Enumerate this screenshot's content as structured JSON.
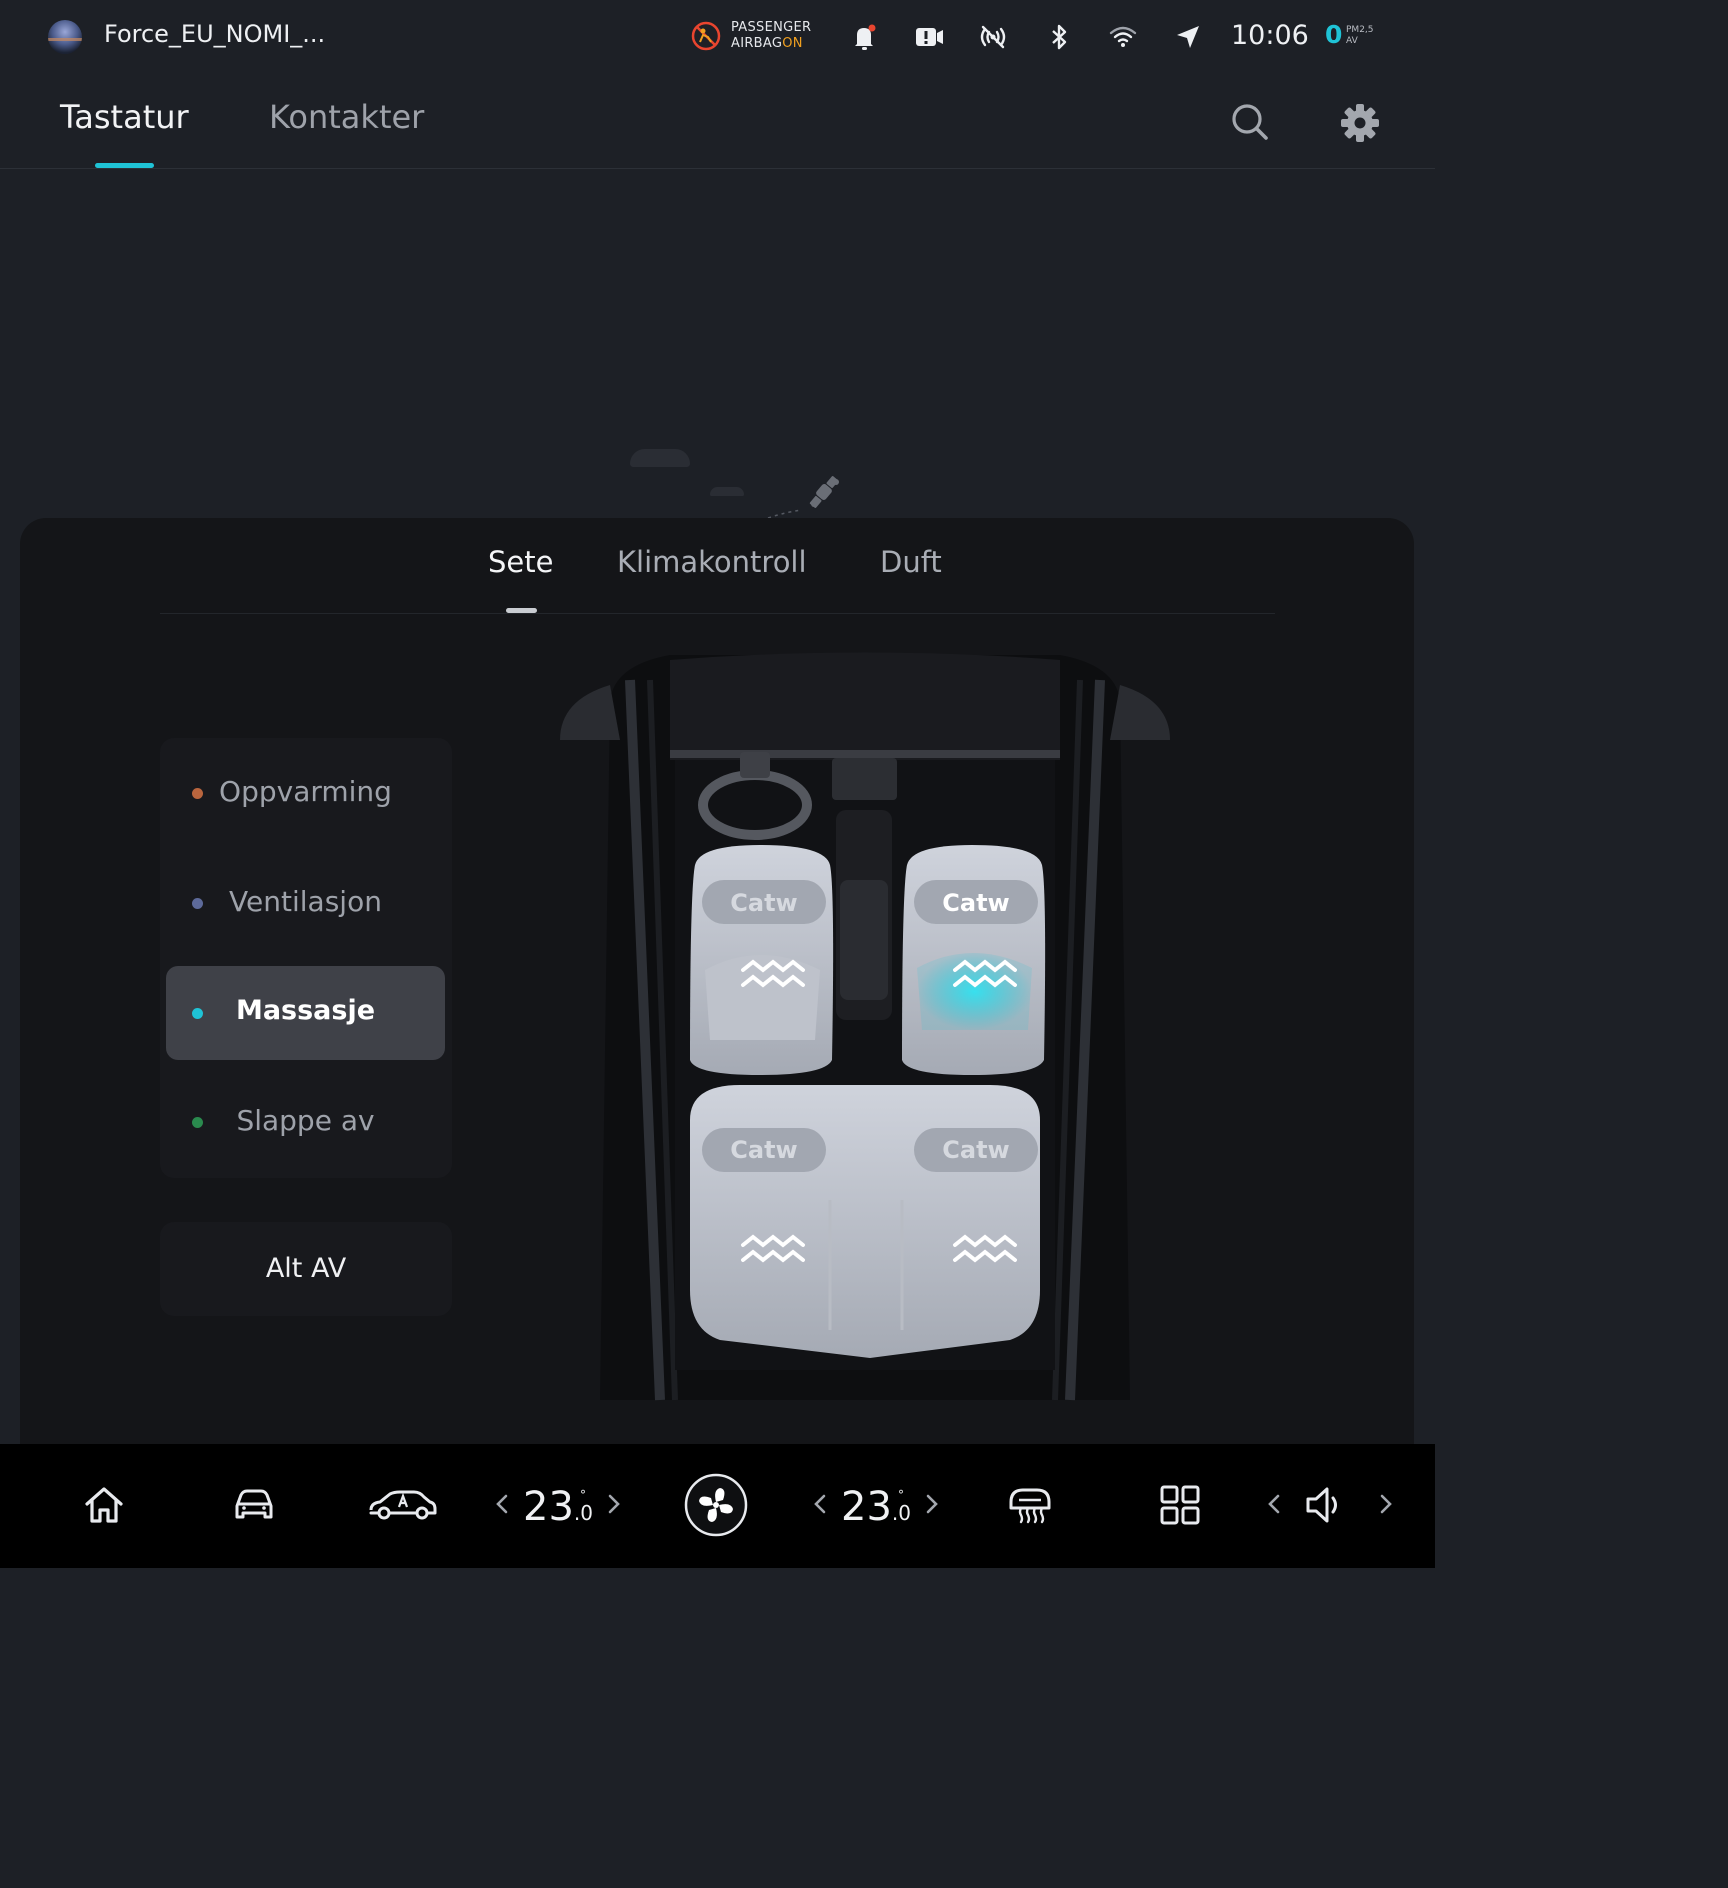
{
  "status_bar": {
    "profile_name": "Force_EU_NOMI_...",
    "airbag_line1": "PASSENGER",
    "airbag_line2": "AIRBAG",
    "airbag_state": "ON",
    "time": "10:06",
    "pm_value": "0",
    "pm_label_top": "PM2,5",
    "pm_label_bottom": "AV",
    "icons": [
      "avatar",
      "airbag-off-icon",
      "notification-bell-icon",
      "dashcam-icon",
      "no-signal-icon",
      "bluetooth-icon",
      "wifi-icon",
      "navigation-arrow-icon"
    ],
    "colors": {
      "accent": "#1fc3d6",
      "airbag_on": "#f0a020",
      "airbag_icon": "#e8452f"
    }
  },
  "top_tabs": {
    "items": [
      {
        "label": "Tastatur",
        "active": true
      },
      {
        "label": "Kontakter",
        "active": false
      }
    ],
    "icons": [
      "search-icon",
      "gear-icon"
    ]
  },
  "panel": {
    "tabs": [
      {
        "label": "Sete",
        "active": true
      },
      {
        "label": "Klimakontroll",
        "active": false
      },
      {
        "label": "Duft",
        "active": false
      }
    ],
    "modes": [
      {
        "label": "Oppvarming",
        "dot_color": "#b9653e",
        "active": false
      },
      {
        "label": "Ventilasjon",
        "dot_color": "#5d6a9a",
        "active": false
      },
      {
        "label": "Massasje",
        "dot_color": "#1fc3d6",
        "active": true
      },
      {
        "label": "Slappe av",
        "dot_color": "#2a8a4e",
        "active": false
      }
    ],
    "all_off_label": "Alt AV",
    "seats": [
      {
        "position": "front-left",
        "label": "Catw",
        "active": false
      },
      {
        "position": "front-right",
        "label": "Catw",
        "active": true
      },
      {
        "position": "rear-left",
        "label": "Catw",
        "active": false
      },
      {
        "position": "rear-right",
        "label": "Catw",
        "active": false
      }
    ]
  },
  "bottom_bar": {
    "icons": [
      "home-icon",
      "car-front-icon",
      "car-side-icon",
      "fan-icon",
      "rear-defrost-icon",
      "apps-grid-icon",
      "volume-icon"
    ],
    "temp_left": {
      "whole": "23",
      "decimal": ".0",
      "unit": "°"
    },
    "temp_right": {
      "whole": "23",
      "decimal": ".0",
      "unit": "°"
    }
  }
}
